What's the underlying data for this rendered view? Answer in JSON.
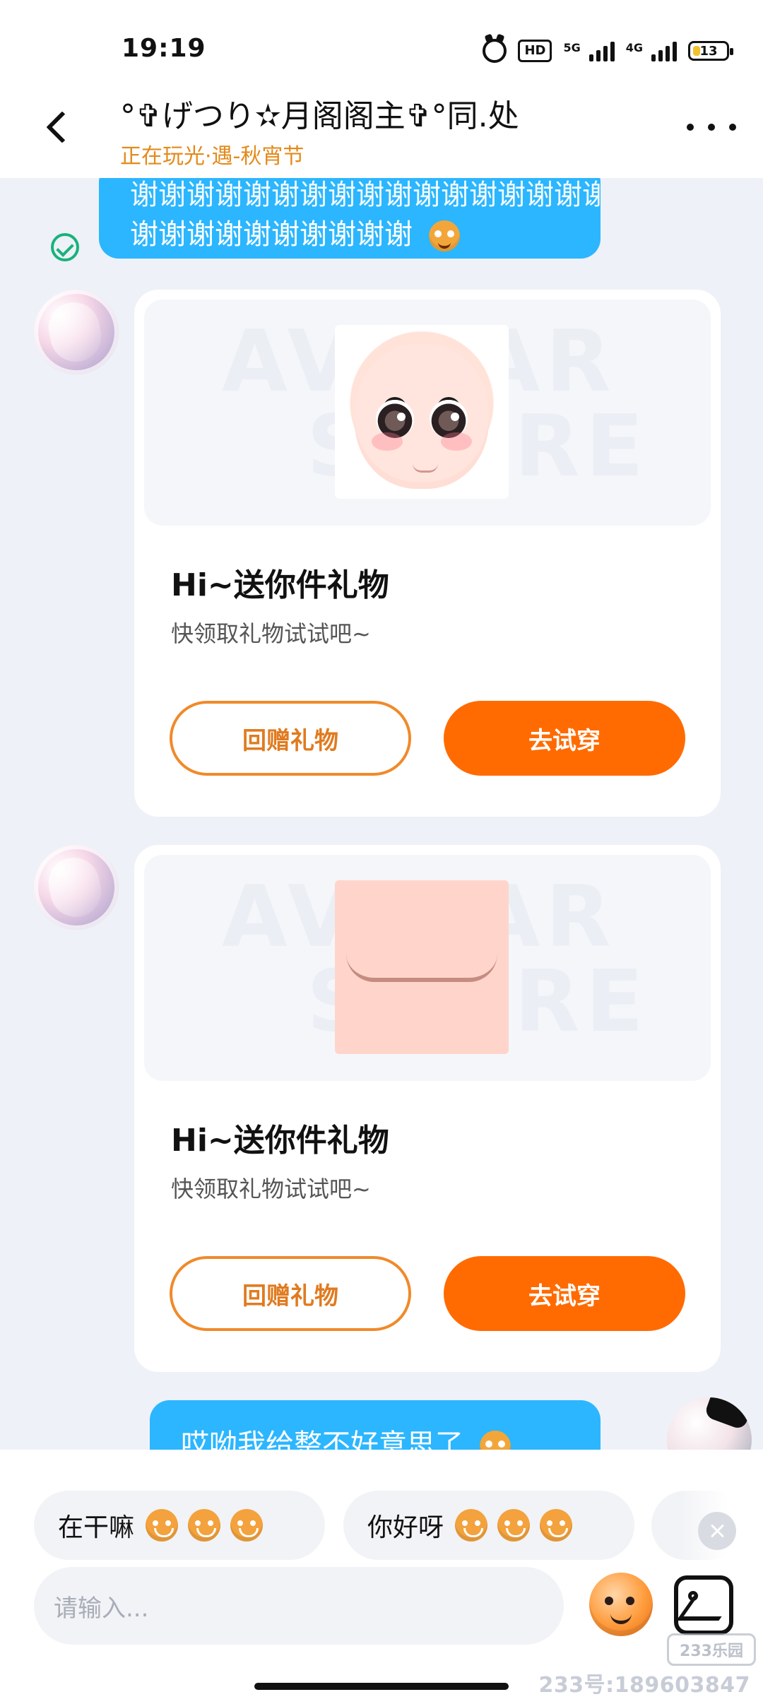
{
  "status_bar": {
    "time": "19:19",
    "hd_label": "HD",
    "signal_1_label": "5G",
    "signal_2_label": "4G",
    "battery_text": "13"
  },
  "header": {
    "title": "°✞げつり✫月阁阁主✞°同.处",
    "subtitle": "正在玩光·遇-秋宵节"
  },
  "chat": {
    "top_bubble": {
      "line1": "谢谢谢谢谢谢谢谢谢谢谢谢谢谢谢谢谢谢谢谢",
      "line2": "谢谢谢谢谢谢谢谢谢谢"
    },
    "gift_cards": [
      {
        "watermark_line1": "AVATAR",
        "watermark_line2": "STORE",
        "title": "Hi~送你件礼物",
        "subtitle": "快领取礼物试试吧~",
        "left_button": "回赠礼物",
        "right_button": "去试穿",
        "preview_kind": "face"
      },
      {
        "watermark_line1": "AVATAR",
        "watermark_line2": "STORE",
        "title": "Hi~送你件礼物",
        "subtitle": "快领取礼物试试吧~",
        "left_button": "回赠礼物",
        "right_button": "去试穿",
        "preview_kind": "lips"
      }
    ],
    "bottom_bubble": {
      "text": "哎呦我给整不好意思了"
    }
  },
  "composer": {
    "quick_replies": [
      {
        "text": "在干嘛"
      },
      {
        "text": "你好呀"
      },
      {
        "text": ""
      }
    ],
    "input_placeholder": "请输入...",
    "watermark_badge": "233乐园",
    "footer_id": "233号:189603847"
  }
}
